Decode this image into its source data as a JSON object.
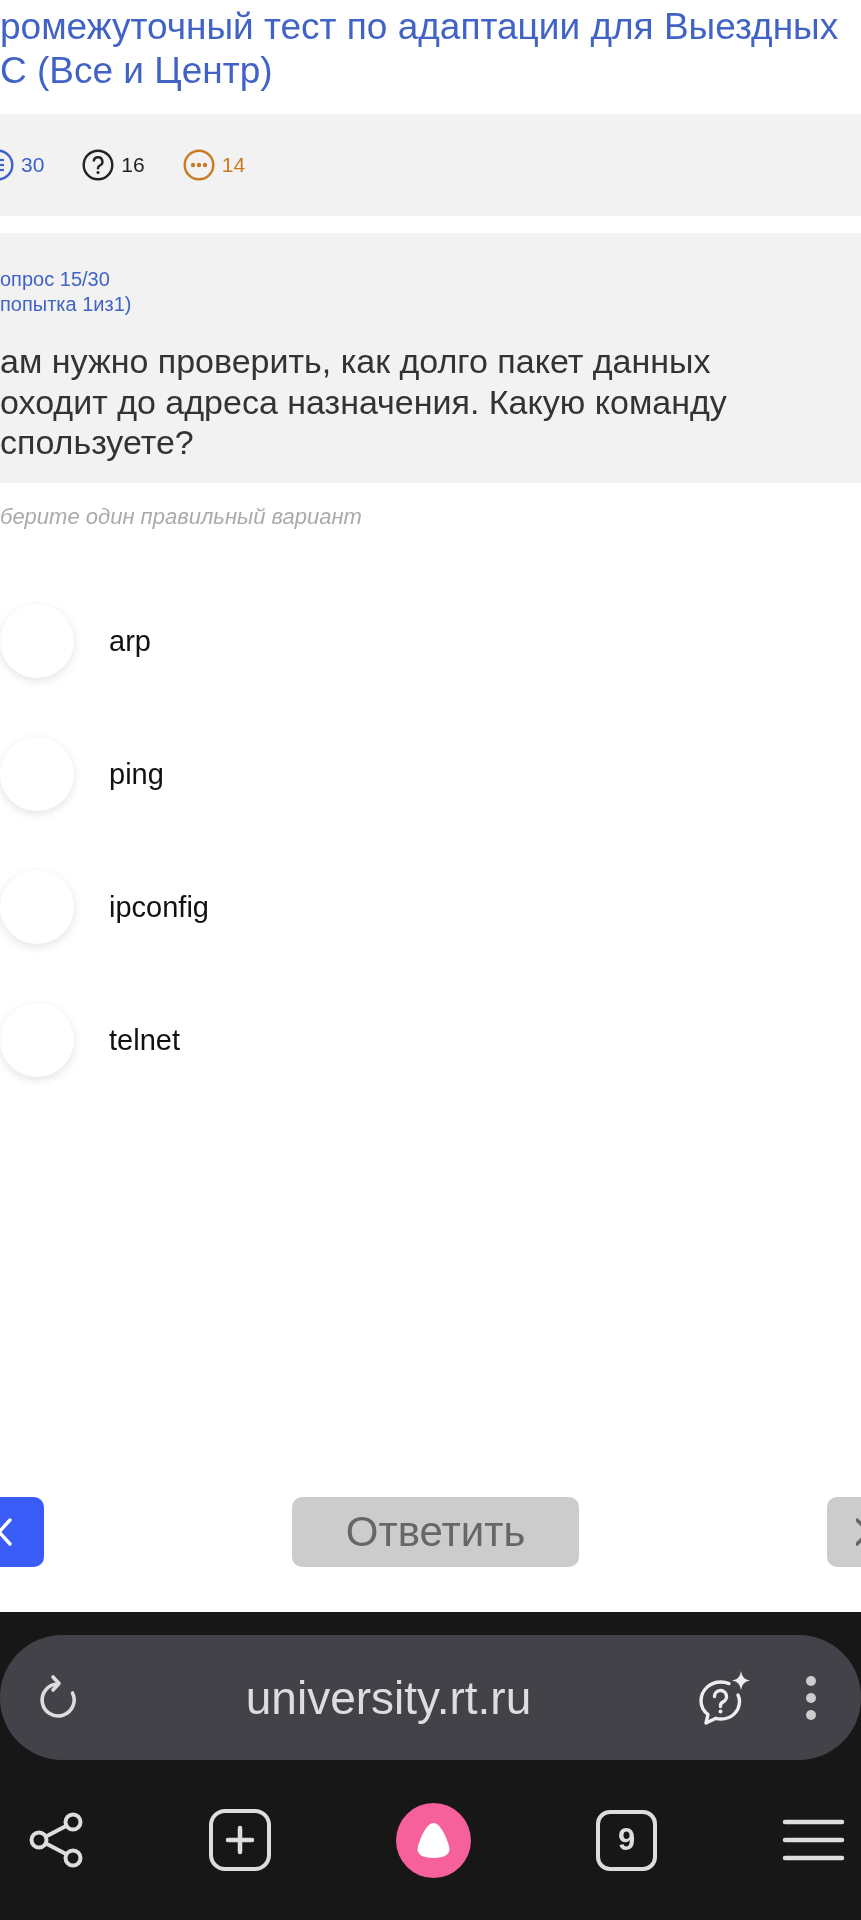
{
  "title": "ромежуточный тест по адаптации для Выездных\nС (Все и Центр)",
  "stats": [
    {
      "kind": "lines",
      "value": "30",
      "color": "#3d63c9"
    },
    {
      "kind": "question",
      "value": "16",
      "color": "#222222"
    },
    {
      "kind": "dots",
      "value": "14",
      "color": "#c97b24"
    }
  ],
  "question": {
    "label": "опрос 15/30\nпопытка 1из1)",
    "text": "ам нужно проверить, как долго пакет данных\nоходит до адреса назначения. Какую команду\nспользуете?",
    "hint": "берите один правильный вариант"
  },
  "options": [
    {
      "label": "arp",
      "selected": false
    },
    {
      "label": "ping",
      "selected": false
    },
    {
      "label": "ipconfig",
      "selected": false
    },
    {
      "label": "telnet",
      "selected": false
    }
  ],
  "actions": [
    {
      "kind": "prev",
      "disabled": false
    },
    {
      "kind": "submit",
      "label": "Ответить",
      "disabled": true
    },
    {
      "kind": "next",
      "disabled": true
    }
  ],
  "browser": {
    "url": "university.rt.ru",
    "tab_count": "9"
  }
}
